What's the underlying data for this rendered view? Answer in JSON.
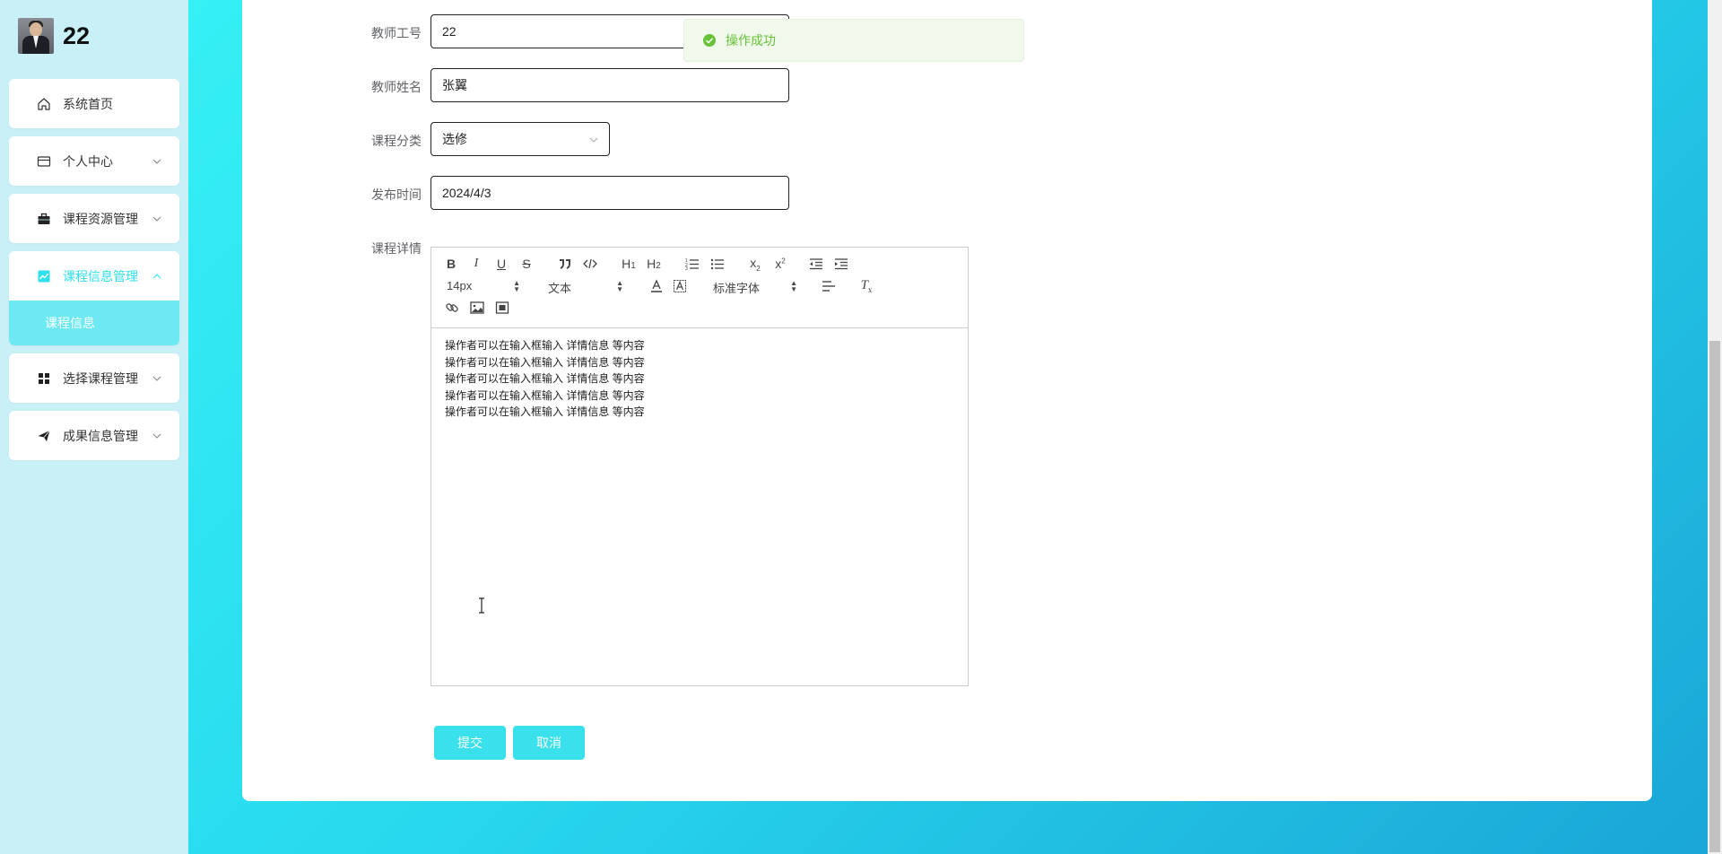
{
  "sidebar": {
    "username": "22",
    "items": [
      {
        "label": "系统首页",
        "icon": "home-icon"
      },
      {
        "label": "个人中心",
        "icon": "card-icon"
      },
      {
        "label": "课程资源管理",
        "icon": "briefcase-icon"
      },
      {
        "label": "课程信息管理",
        "icon": "trend-chart-icon"
      },
      {
        "label": "选择课程管理",
        "icon": "grid-icon"
      },
      {
        "label": "成果信息管理",
        "icon": "paper-plane-icon"
      }
    ],
    "active_sub": "课程信息"
  },
  "form": {
    "teacher_id_label": "教师工号",
    "teacher_id_value": "22",
    "teacher_name_label": "教师姓名",
    "teacher_name_value": "张翼",
    "category_label": "课程分类",
    "category_value": "选修",
    "publish_time_label": "发布时间",
    "publish_time_value": "2024/4/3",
    "details_label": "课程详情",
    "editor": {
      "font_size": "14px",
      "header_select": "文本",
      "font_family": "标准字体",
      "lines": [
        "操作者可以在输入框输入 详情信息 等内容",
        "操作者可以在输入框输入 详情信息 等内容",
        "操作者可以在输入框输入 详情信息 等内容",
        "操作者可以在输入框输入 详情信息 等内容",
        "操作者可以在输入框输入 详情信息 等内容"
      ]
    },
    "submit_label": "提交",
    "cancel_label": "取消"
  },
  "toast": {
    "message": "操作成功",
    "status_color": "#67c23a"
  },
  "colors": {
    "accent": "#3ae0ec",
    "sidebar_bg": "#c9f0f7",
    "active_text": "#2ee0ec"
  }
}
